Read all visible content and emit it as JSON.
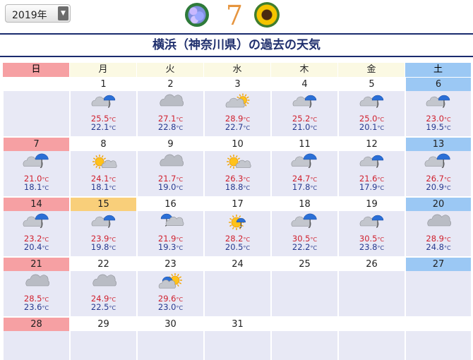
{
  "header": {
    "year_select": "2019年",
    "month": "7",
    "title": "横浜（神奈川県）の過去の天気"
  },
  "weekdays": [
    "日",
    "月",
    "火",
    "水",
    "木",
    "金",
    "土"
  ],
  "colors": {
    "sunday": "#f6a0a3",
    "saturday": "#9bc8f4",
    "high": "#d0202e",
    "low": "#283a8f",
    "today": "#f9cf7a"
  },
  "weeks": [
    [
      null,
      {
        "day": "1",
        "weather": "rain-cloud",
        "high": "25.5",
        "low": "22.1"
      },
      {
        "day": "2",
        "weather": "cloud",
        "high": "27.1",
        "low": "22.8"
      },
      {
        "day": "3",
        "weather": "cloud-sun",
        "high": "28.9",
        "low": "22.7"
      },
      {
        "day": "4",
        "weather": "rain-cloud",
        "high": "25.2",
        "low": "21.0"
      },
      {
        "day": "5",
        "weather": "rain-cloud",
        "high": "25.0",
        "low": "20.1"
      },
      {
        "day": "6",
        "weather": "rain-cloud",
        "high": "23.0",
        "low": "19.5"
      }
    ],
    [
      {
        "day": "7",
        "weather": "cloud-umbrella",
        "high": "21.0",
        "low": "18.1"
      },
      {
        "day": "8",
        "weather": "sun-cloud",
        "high": "24.1",
        "low": "18.1"
      },
      {
        "day": "9",
        "weather": "cloud",
        "high": "21.7",
        "low": "19.0"
      },
      {
        "day": "10",
        "weather": "sun-cloud",
        "high": "26.3",
        "low": "18.8"
      },
      {
        "day": "11",
        "weather": "cloud-umbrella",
        "high": "24.7",
        "low": "17.8"
      },
      {
        "day": "12",
        "weather": "rain-cloud",
        "high": "21.6",
        "low": "17.9"
      },
      {
        "day": "13",
        "weather": "cloud-umbrella",
        "high": "26.7",
        "low": "20.9"
      }
    ],
    [
      {
        "day": "14",
        "weather": "cloud-umbrella",
        "high": "23.2",
        "low": "20.4"
      },
      {
        "day": "15",
        "weather": "rain-cloud",
        "high": "23.9",
        "low": "19.8",
        "today": true
      },
      {
        "day": "16",
        "weather": "umbrella-cloud",
        "high": "21.9",
        "low": "19.3"
      },
      {
        "day": "17",
        "weather": "sun-umbrella",
        "high": "28.2",
        "low": "20.5"
      },
      {
        "day": "18",
        "weather": "cloud-umbrella",
        "high": "30.5",
        "low": "22.2"
      },
      {
        "day": "19",
        "weather": "rain-cloud",
        "high": "30.5",
        "low": "23.8"
      },
      {
        "day": "20",
        "weather": "cloud",
        "high": "28.9",
        "low": "24.8"
      }
    ],
    [
      {
        "day": "21",
        "weather": "cloud",
        "high": "28.5",
        "low": "23.6"
      },
      {
        "day": "22",
        "weather": "cloud",
        "high": "24.9",
        "low": "22.5"
      },
      {
        "day": "23",
        "weather": "sun-umbrella-cloud",
        "high": "29.6",
        "low": "23.0"
      },
      {
        "day": "24"
      },
      {
        "day": "25"
      },
      {
        "day": "26"
      },
      {
        "day": "27"
      }
    ],
    [
      {
        "day": "28"
      },
      {
        "day": "29"
      },
      {
        "day": "30"
      },
      {
        "day": "31"
      },
      null,
      null,
      null
    ]
  ],
  "temp_unit": "°C"
}
